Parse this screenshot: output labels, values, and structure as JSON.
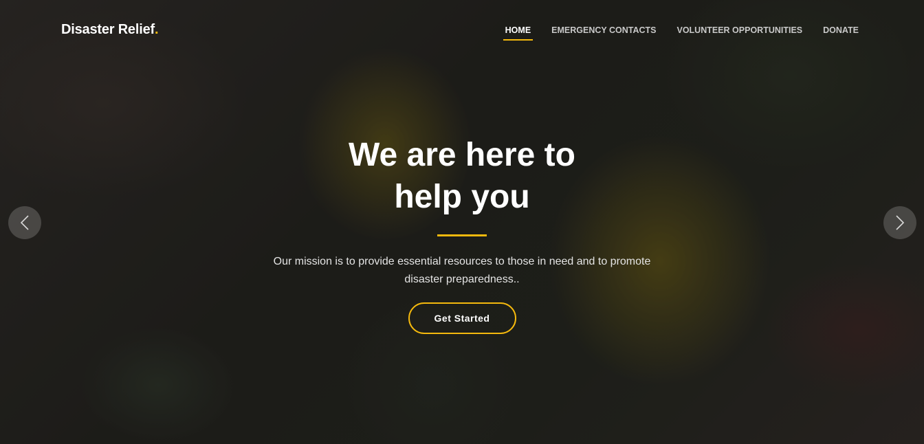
{
  "header": {
    "logo_text": "Disaster Relief",
    "logo_dot": ".",
    "nav": [
      {
        "label": "HOME",
        "active": true
      },
      {
        "label": "EMERGENCY CONTACTS",
        "active": false
      },
      {
        "label": "VOLUNTEER OPPORTUNITIES",
        "active": false
      },
      {
        "label": "DONATE",
        "active": false
      }
    ]
  },
  "hero": {
    "title_line1": "We are here to",
    "title_line2": "help you",
    "text": "Our mission is to provide essential resources to those in need and to promote disaster preparedness..",
    "button_label": "Get Started"
  },
  "carousel": {
    "prev_icon": "chevron-left-icon",
    "next_icon": "chevron-right-icon"
  },
  "colors": {
    "accent": "#f5b90d",
    "text": "#ffffff"
  }
}
